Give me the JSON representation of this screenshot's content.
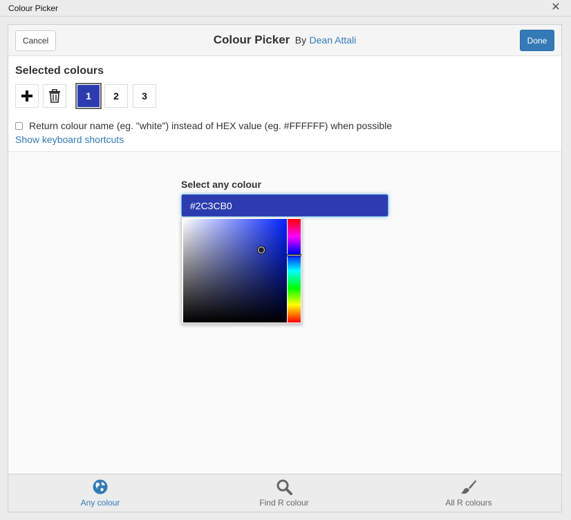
{
  "window": {
    "title": "Colour Picker"
  },
  "header": {
    "cancel_label": "Cancel",
    "done_label": "Done",
    "title": "Colour Picker",
    "by": "By",
    "author": "Dean Attali"
  },
  "selected": {
    "heading": "Selected colours",
    "colours": [
      {
        "label": "1",
        "hex": "#2C3CB0",
        "active": true
      },
      {
        "label": "2",
        "hex": "#FFFFFF",
        "active": false
      },
      {
        "label": "3",
        "hex": "#FFFFFF",
        "active": false
      }
    ],
    "return_name_label": "Return colour name (eg. \"white\") instead of HEX value (eg. #FFFFFF) when possible",
    "shortcuts_link": "Show keyboard shortcuts"
  },
  "picker": {
    "label": "Select any colour",
    "value": "#2C3CB0"
  },
  "tabs": [
    {
      "label": "Any colour",
      "icon": "globe-icon",
      "active": true
    },
    {
      "label": "Find R colour",
      "icon": "search-icon",
      "active": false
    },
    {
      "label": "All R colours",
      "icon": "paintbrush-icon",
      "active": false
    }
  ],
  "colors": {
    "accent": "#337ab7",
    "selected": "#2c3cb0"
  }
}
